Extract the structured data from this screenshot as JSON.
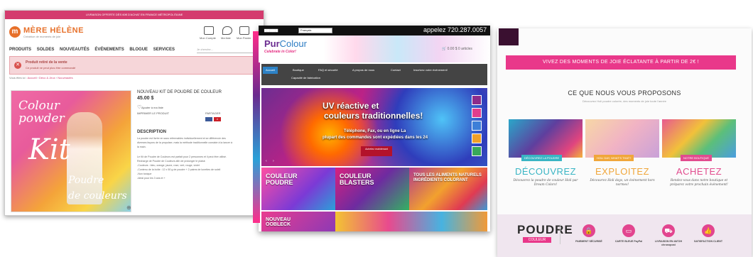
{
  "mere_helene": {
    "topbar_text": "LIVRAISON OFFERTE DÈS 60€ D'ACHAT EN FRANCE MÉTROPOLITAINE",
    "logo_initial": "m",
    "logo_name": "MÈRE HÉLÈNE",
    "logo_tagline": "Créatrice de moments de joie",
    "header_icons": [
      {
        "icon": "account-icon",
        "label": "Mon Compte"
      },
      {
        "icon": "heart-icon",
        "label": "Ma liste"
      },
      {
        "icon": "cart-icon",
        "label": "Mon Panier"
      }
    ],
    "nav": [
      "PRODUITS",
      "SOLDES",
      "NOUVEAUTÉS",
      "ÉVÉNEMENTS",
      "BLOGUE",
      "SERVICES"
    ],
    "search_placeholder": "Je cherche...",
    "alert_title": "Produit retiré de la vente",
    "alert_text": "Ce produit ne peut plus être commandé",
    "breadcrumb": [
      "Vous êtes ici :",
      "Accueil",
      "Déco & Jeux",
      "Nouveautés"
    ],
    "product_image_words": [
      "Colour",
      "powder",
      "Kit",
      "Poudre",
      "de couleurs"
    ],
    "product_title": "NOUVEAU KIT DE POUDRE DE COULEUR",
    "price": "45.00 $",
    "wishlist": "Ajouter à ma liste",
    "print_label": "IMPRIMER LE PRODUIT",
    "share_label": "PARTAGER",
    "description_heading": "DESCRIPTION",
    "description_lines": [
      "La poudre est livrée en sacs refermables individuellement et se différencie des",
      "diverses façons de la propulser, mais la méthode traditionnelle consiste à la lancer à",
      "la main.",
      "",
      "Le Kit de Poudre de Couleurs est parfait pour 2 personnes et il peut être utilisé.",
      "Recharge de Poudre de Couleurs afin de prolonger le plaisir.",
      "-Couleurs : bleu, orange, jaune, rose, vert, rouge, violet",
      "-Contenu de la boîte : 12 x 50 g de poudre + 2 paires de lunettes de soleil",
      "-Non toxique",
      "-Idéal pour les 3 ans et +"
    ]
  },
  "purcolour": {
    "language": "Français",
    "phone": "appelez 720.287.0057",
    "logo_part1": "Pur",
    "logo_part2": "Colour",
    "tagline": "Celebrate in Color!",
    "cart_text": "0.00 $   0 articles",
    "nav": [
      "Accueil",
      "Boutique",
      "FAQ et sécurité",
      "A propos de nous",
      "Contact",
      "Inscrivez votre événement!"
    ],
    "nav_second_row": "Capacité de fabrication",
    "hero_title_1": "UV réactive et",
    "hero_title_2": "couleurs traditionnelles!",
    "hero_sub_1": "Téléphone, Fax, ou en ligne La",
    "hero_sub_2": "plupart des commandes sont expédiées dans les 24",
    "hero_button": "Achetez maintenant",
    "tiles": [
      {
        "line1": "COULEUR",
        "line2": "POUDRE"
      },
      {
        "line1": "COULEUR",
        "line2": "BLASTERS"
      },
      {
        "line1": "TOUS LES ALIMENTS NATURELS",
        "line2": "INGRÉDIENTS COLORANT"
      },
      {
        "line1": "NOUVEAU",
        "line2": "OOBLECK"
      }
    ]
  },
  "poudre_couleur": {
    "banner": "VIVEZ DES MOMENTS DE JOIE ÉCLATANTE À PARTIR DE 2€ !",
    "heading": "CE QUE NOUS VOUS PROPOSONS",
    "subheading": "Découvrez Holi poudre colorée, des moments de joie toute l'année",
    "cards": [
      {
        "tag": "DÉCOUVREZ LA POUDRE",
        "title": "DÉCOUVREZ",
        "text": "Découvrez la poudre de couleur Holi par Dream Colors!",
        "color": "#39b5c4"
      },
      {
        "tag": "HOLI DAY, WHAT'S THAT?",
        "title": "EXPLOITEZ",
        "text": "Découvrez Holi days, un évènement hors normes!",
        "color": "#f0a63a"
      },
      {
        "tag": "NOTRE BOUTIQUE",
        "title": "ACHETEZ",
        "text": "Rendez-vous dans notre boutique et préparez votre prochain évènement!",
        "color": "#e24b8e"
      }
    ],
    "footer_logo_1": "POUDRE",
    "footer_logo_2": "COULEUR",
    "footer_items": [
      {
        "icon": "lock-icon",
        "label": "PAIEMENT SÉCURISÉ"
      },
      {
        "icon": "credit-card-icon",
        "label": "CARTE BLEUE PayPal"
      },
      {
        "icon": "truck-icon",
        "label": "LIVRAISON EN 48/72H chronopost"
      },
      {
        "icon": "thumbs-up-icon",
        "label": "SATISFACTION CLIENT"
      }
    ]
  }
}
